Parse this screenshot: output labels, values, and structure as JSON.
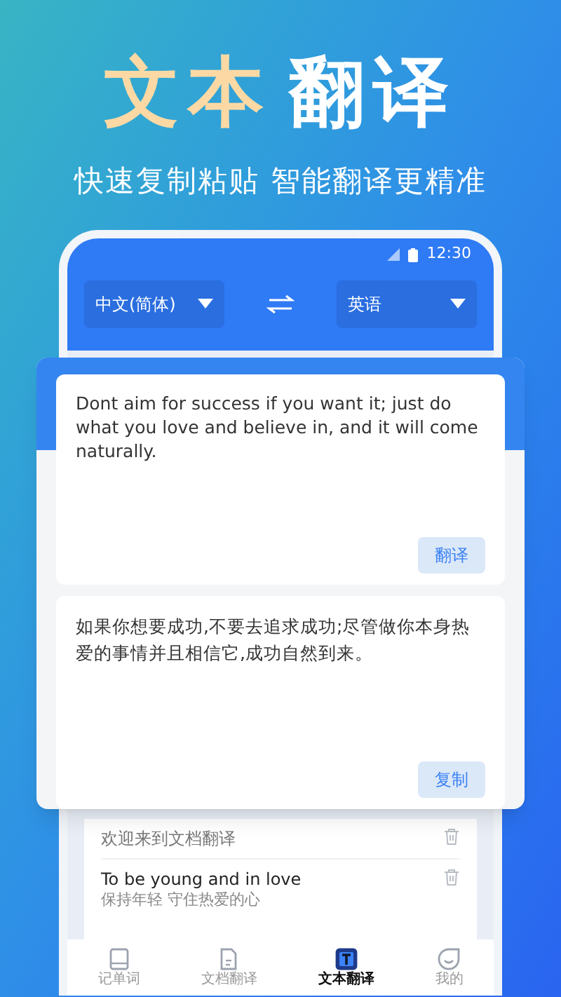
{
  "headline": [
    {
      "text": "文本",
      "accent": true
    },
    {
      "text": "翻译",
      "accent": false
    }
  ],
  "subtitle": "快速复制粘贴 智能翻译更精准",
  "status_bar": {
    "time": "12:30"
  },
  "languages": {
    "source": "中文(简体)",
    "target": "英语"
  },
  "input": {
    "text": "Dont aim for success if you want it; just do what you love and believe in, and it will come naturally.",
    "button": "翻译"
  },
  "output": {
    "text": "如果你想要成功,不要去追求成功;尽管做你本身热爱的事情并且相信它,成功自然到来。",
    "button": "复制"
  },
  "history": [
    {
      "source": "欢迎来到文档翻译"
    },
    {
      "source": "To be young and in love",
      "target": "保持年轻 守住热爱的心"
    }
  ],
  "nav": [
    {
      "label": "记单词",
      "kind": "book",
      "selected": false
    },
    {
      "label": "文档翻译",
      "kind": "document",
      "selected": false
    },
    {
      "label": "文本翻译",
      "kind": "text",
      "selected": true
    },
    {
      "label": "我的",
      "kind": "face",
      "selected": false
    }
  ]
}
